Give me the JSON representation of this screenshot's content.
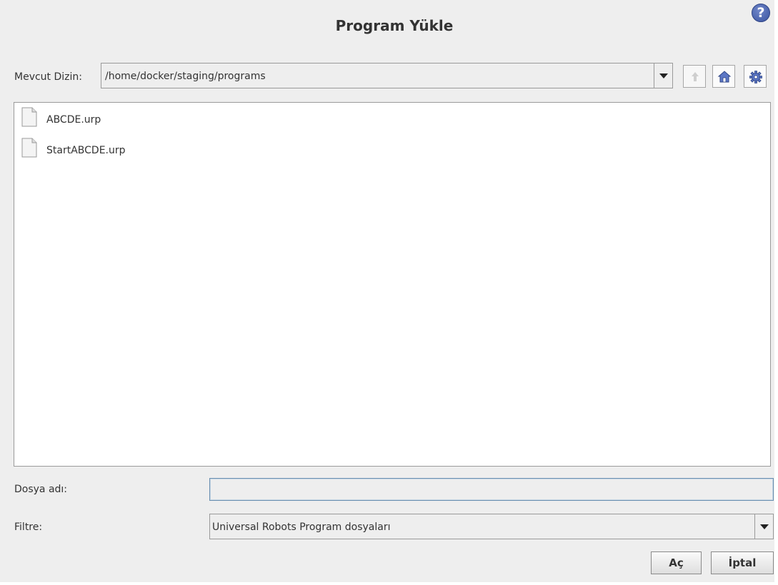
{
  "dialog": {
    "title": "Program Yükle",
    "help_icon": "question-mark-icon"
  },
  "directory": {
    "label": "Mevcut Dizin:",
    "value": "/home/docker/staging/programs",
    "buttons": [
      {
        "name": "up-folder-button",
        "icon": "arrow-up-icon",
        "enabled": false
      },
      {
        "name": "home-folder-button",
        "icon": "home-icon",
        "enabled": true
      },
      {
        "name": "settings-button",
        "icon": "gear-icon",
        "enabled": true
      }
    ]
  },
  "files": [
    {
      "name": "ABCDE.urp",
      "icon": "document-icon"
    },
    {
      "name": "StartABCDE.urp",
      "icon": "document-icon"
    }
  ],
  "filename": {
    "label": "Dosya adı:",
    "value": ""
  },
  "filter": {
    "label": "Filtre:",
    "value": "Universal Robots Program dosyaları"
  },
  "actions": {
    "open_label": "Aç",
    "cancel_label": "İptal"
  },
  "colors": {
    "background": "#eeeeee",
    "accent": "#3a54a0"
  }
}
